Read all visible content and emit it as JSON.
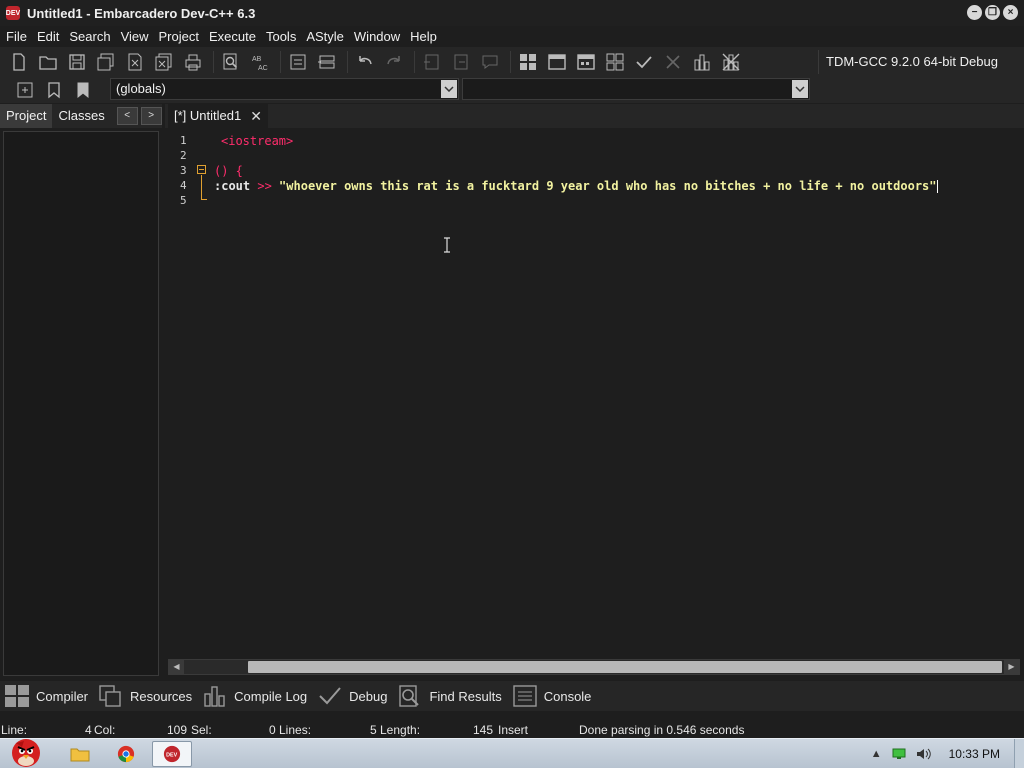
{
  "window": {
    "title": "Untitled1 - Embarcadero Dev-C++ 6.3",
    "app_icon_text": "DEV"
  },
  "menu": [
    "File",
    "Edit",
    "Search",
    "View",
    "Project",
    "Execute",
    "Tools",
    "AStyle",
    "Window",
    "Help"
  ],
  "toolbar": {
    "compiler": "TDM-GCC 9.2.0 64-bit Debug"
  },
  "toolbar2": {
    "globals": "(globals)"
  },
  "left_panel": {
    "tabs": [
      "Project",
      "Classes"
    ],
    "nav_prev": "<",
    "nav_next": ">"
  },
  "editor": {
    "tab_label": "[*] Untitled1",
    "tab_close": "✕",
    "line_numbers": [
      "1",
      "2",
      "3",
      "4",
      "5"
    ],
    "lines": {
      "l1": "<iostream>",
      "l3": "() {",
      "l4_id": ":cout",
      "l4_op": ">>",
      "l4_str": "\"whoever owns this rat is a fucktard 9 year old who has no bitches + no life + no outdoors\""
    }
  },
  "bottom_tabs": [
    "Compiler",
    "Resources",
    "Compile Log",
    "Debug",
    "Find Results",
    "Console"
  ],
  "status": {
    "line_label": "Line:",
    "line_val": "4",
    "col_label": "Col:",
    "col_val": "109",
    "sel_label": "Sel:",
    "sel_val": "0",
    "lines_label": "Lines:",
    "lines_val": "5",
    "length_label": "Length:",
    "length_val": "145",
    "mode": "Insert",
    "message": "Done parsing in 0.546 seconds"
  },
  "taskbar": {
    "clock": "10:33 PM"
  },
  "colors": {
    "preprocessor": "#ff2d6c",
    "string": "#f2f2a0",
    "fold": "#e0a030",
    "background": "#1e1e1e"
  }
}
